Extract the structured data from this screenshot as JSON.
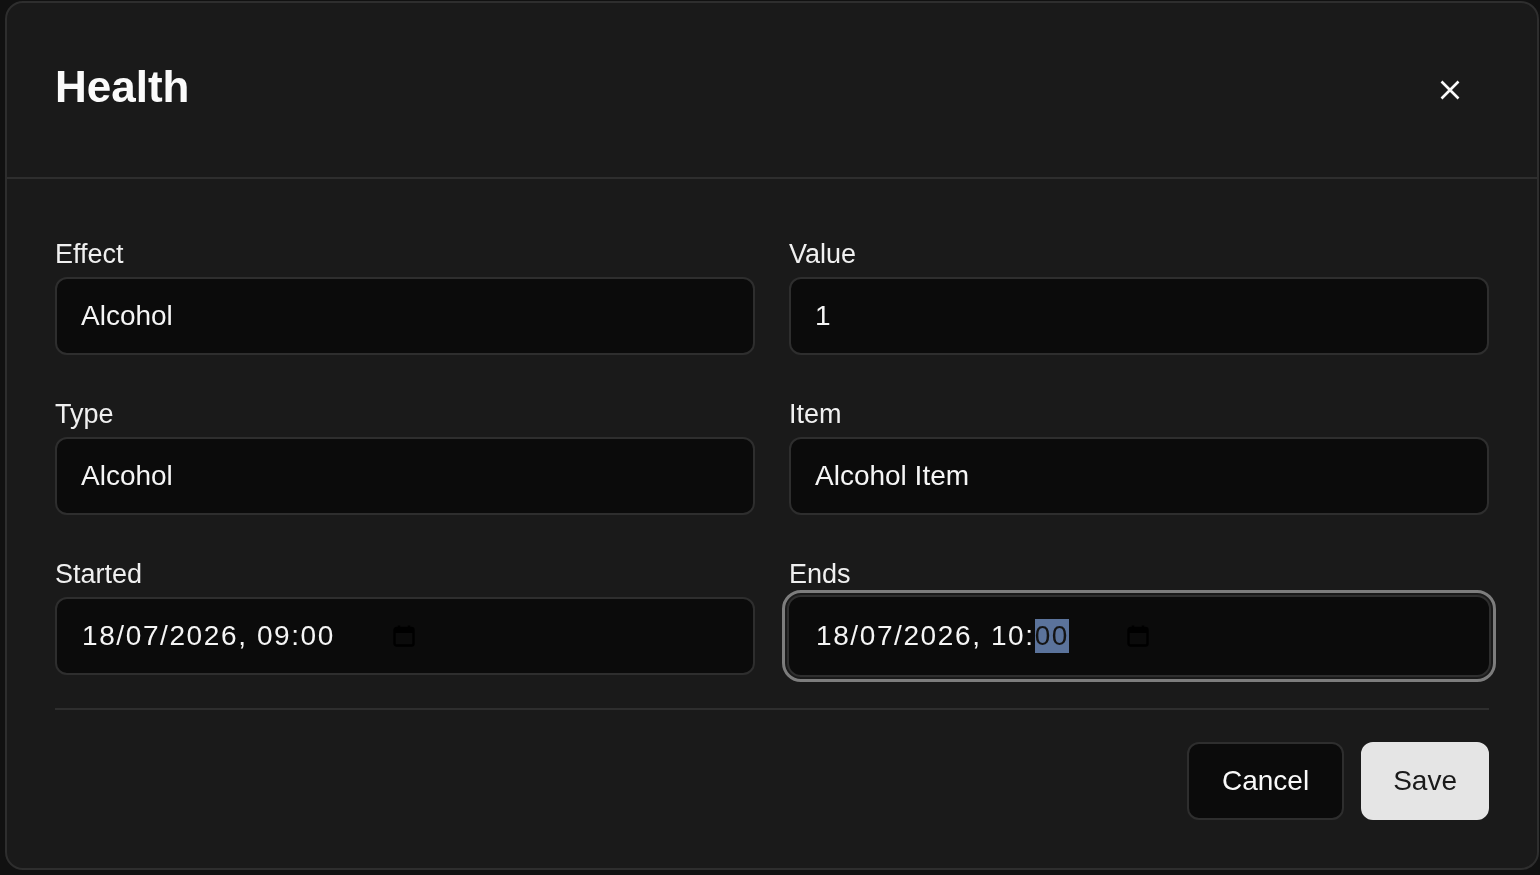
{
  "dialog": {
    "title": "Health"
  },
  "fields": [
    {
      "kind": "text",
      "label": "Effect",
      "value": "Alcohol",
      "focused": false
    },
    {
      "kind": "text",
      "label": "Value",
      "value": "1",
      "focused": false
    },
    {
      "kind": "text",
      "label": "Type",
      "value": "Alcohol",
      "focused": false
    },
    {
      "kind": "text",
      "label": "Item",
      "value": "Alcohol Item",
      "focused": false
    },
    {
      "kind": "datetime",
      "label": "Started",
      "focused": false,
      "segments": [
        {
          "text": "18/07/2026, 09:00",
          "selected": false
        }
      ]
    },
    {
      "kind": "datetime",
      "label": "Ends",
      "focused": true,
      "segments": [
        {
          "text": "18/07/2026, 10:",
          "selected": false
        },
        {
          "text": "00",
          "selected": true
        }
      ]
    }
  ],
  "buttons": [
    {
      "kind": "secondary",
      "label": "Cancel"
    },
    {
      "kind": "primary",
      "label": "Save"
    }
  ]
}
